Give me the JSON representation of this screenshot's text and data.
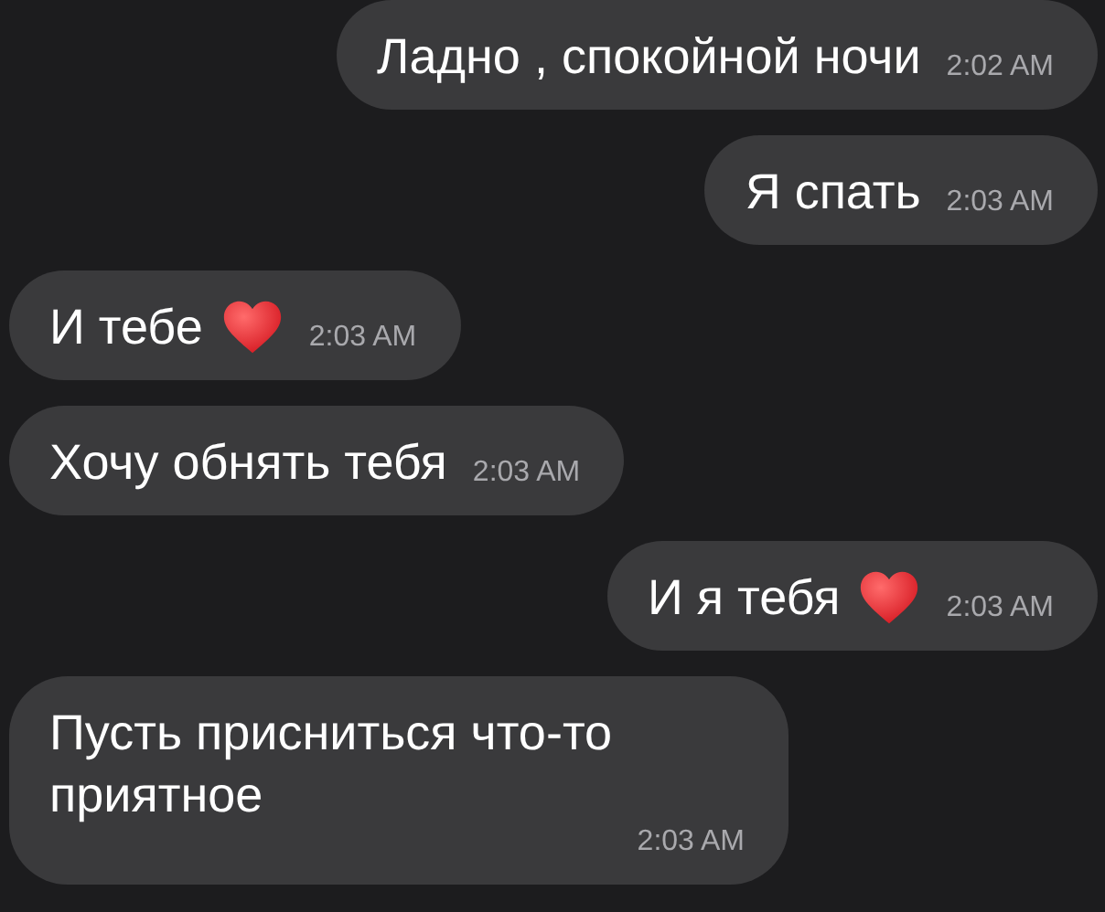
{
  "messages": [
    {
      "text": "Ладно , спокойной ночи",
      "time": "2:02 AM",
      "outgoing": true,
      "heart": false
    },
    {
      "text": "Я спать",
      "time": "2:03 AM",
      "outgoing": true,
      "heart": false
    },
    {
      "text": "И тебе",
      "time": "2:03 AM",
      "outgoing": false,
      "heart": true
    },
    {
      "text": "Хочу обнять тебя",
      "time": "2:03 AM",
      "outgoing": false,
      "heart": false
    },
    {
      "text": "И я тебя",
      "time": "2:03 AM",
      "outgoing": true,
      "heart": true
    },
    {
      "text": "Пусть присниться что-то приятное",
      "time": "2:03 AM",
      "outgoing": false,
      "heart": false
    }
  ]
}
